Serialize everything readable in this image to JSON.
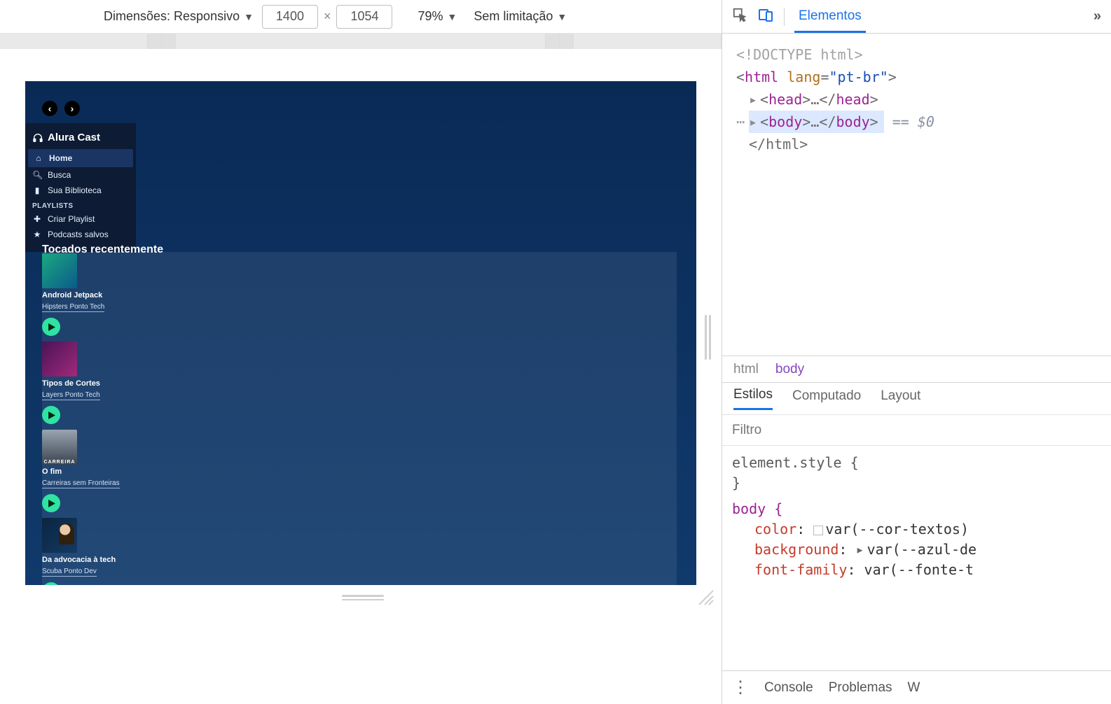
{
  "toolbar": {
    "dimensions_label": "Dimensões: Responsivo",
    "width": "1400",
    "height": "1054",
    "zoom": "79%",
    "throttling": "Sem limitação"
  },
  "app": {
    "brand": "Alura Cast",
    "sidebar": {
      "items": [
        {
          "label": "Home"
        },
        {
          "label": "Busca"
        },
        {
          "label": "Sua Biblioteca"
        }
      ],
      "playlists_heading": "PLAYLISTS",
      "playlist_actions": [
        {
          "label": "Criar Playlist"
        },
        {
          "label": "Podcasts salvos"
        }
      ]
    },
    "section_title": "Tocados recentemente",
    "cards": [
      {
        "title": "Android Jetpack",
        "subtitle": "Hipsters Ponto Tech"
      },
      {
        "title": "Tipos de Cortes",
        "subtitle": "Layers Ponto Tech"
      },
      {
        "title": "O fim",
        "subtitle": "Carreiras sem Fronteiras",
        "thumb_text": "CARREIRA"
      },
      {
        "title": "Da advocacia à tech",
        "subtitle": "Scuba Ponto Dev"
      }
    ]
  },
  "devtools": {
    "tabs": {
      "elements": "Elementos"
    },
    "dom": {
      "doctype": "<!DOCTYPE html>",
      "html_open_tag": "html",
      "html_attr_name": "lang",
      "html_attr_value": "\"pt-br\"",
      "head_tag": "head",
      "body_tag": "body",
      "html_close": "</html>",
      "eq_dollar": "== $0",
      "ellips": "…"
    },
    "breadcrumb": {
      "a": "html",
      "b": "body"
    },
    "styles_tabs": {
      "styles": "Estilos",
      "computed": "Computado",
      "layout": "Layout"
    },
    "filter_placeholder": "Filtro",
    "styles": {
      "element_style_label": "element.style {",
      "closing": "}",
      "body_sel": "body  {",
      "props": [
        {
          "name": "color",
          "value": "var(--cor-textos)",
          "swatch": true
        },
        {
          "name": "background",
          "value": "var(--azul-de",
          "toggle": true
        },
        {
          "name": "font-family",
          "value": "var(--fonte-t"
        }
      ]
    },
    "drawer": {
      "console": "Console",
      "problems": "Problemas",
      "more": "W"
    }
  }
}
